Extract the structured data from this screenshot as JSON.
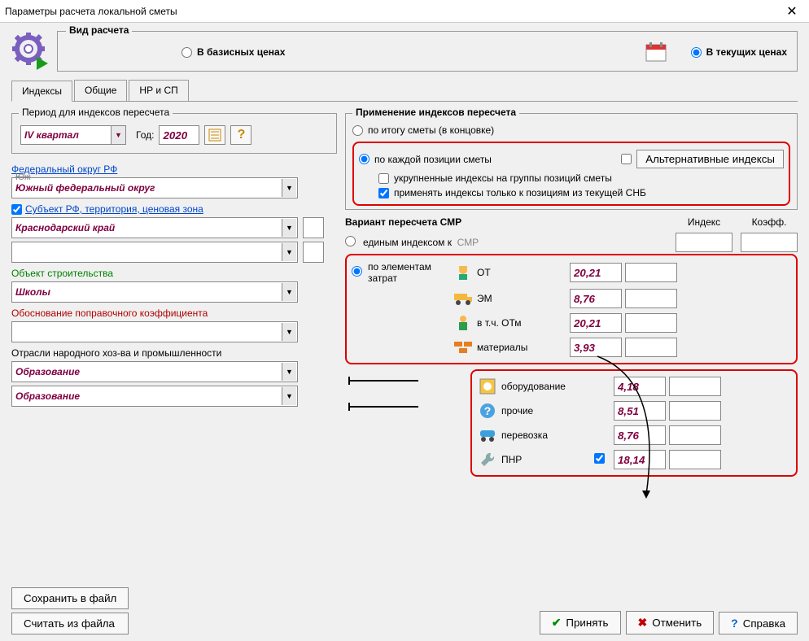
{
  "title": "Параметры расчета локальной сметы",
  "calc_type": {
    "legend": "Вид расчета",
    "base": "В базисных ценах",
    "current": "В текущих ценах"
  },
  "tabs": [
    "Индексы",
    "Общие",
    "НР и СП"
  ],
  "period": {
    "legend": "Период для индексов пересчета",
    "quarter": "IV квартал",
    "year_label": "Год:",
    "year": "2020"
  },
  "fed_district_label": "Федеральный округ РФ",
  "fed_district_value": "Южный федеральный округ",
  "subject_chk": "Субъект РФ, территория, ценовая зона",
  "subject_value": "Краснодарский край",
  "obj_label": "Объект строительства",
  "obj_value": "Школы",
  "coef_label": "Обоснование поправочного коэффициента",
  "industry_label": "Отрасли народного хоз-ва и промышленности",
  "industry1": "Образование",
  "industry2": "Образование",
  "apply": {
    "legend": "Применение индексов пересчета",
    "opt1": "по итогу сметы (в концовке)",
    "opt2": "по каждой позиции сметы",
    "alt_btn": "Альтернативные индексы",
    "sub1": "укрупненные индексы на группы позиций сметы",
    "sub2": "применять индексы только к позициям из текущей СНБ"
  },
  "variant": {
    "title": "Вариант пересчета СМР",
    "col_index": "Индекс",
    "col_coef": "Коэфф.",
    "opt_single": "единым индексом к",
    "smr": "СМР",
    "opt_elements": "по элементам затрат",
    "rows": {
      "ot": {
        "label": "ОТ",
        "value": "20,21"
      },
      "em": {
        "label": "ЭМ",
        "value": "8,76"
      },
      "otm": {
        "label": "в т.ч. ОТм",
        "value": "20,21"
      },
      "mat": {
        "label": "материалы",
        "value": "3,93"
      },
      "equip": {
        "label": "оборудование",
        "value": "4,18"
      },
      "other": {
        "label": "прочие",
        "value": "8,51"
      },
      "trans": {
        "label": "перевозка",
        "value": "8,76"
      },
      "pnr": {
        "label": "ПНР",
        "value": "18,14"
      }
    }
  },
  "buttons": {
    "save_file": "Сохранить в файл",
    "load_file": "Считать из файла",
    "accept": "Принять",
    "cancel": "Отменить",
    "help": "Справка"
  }
}
